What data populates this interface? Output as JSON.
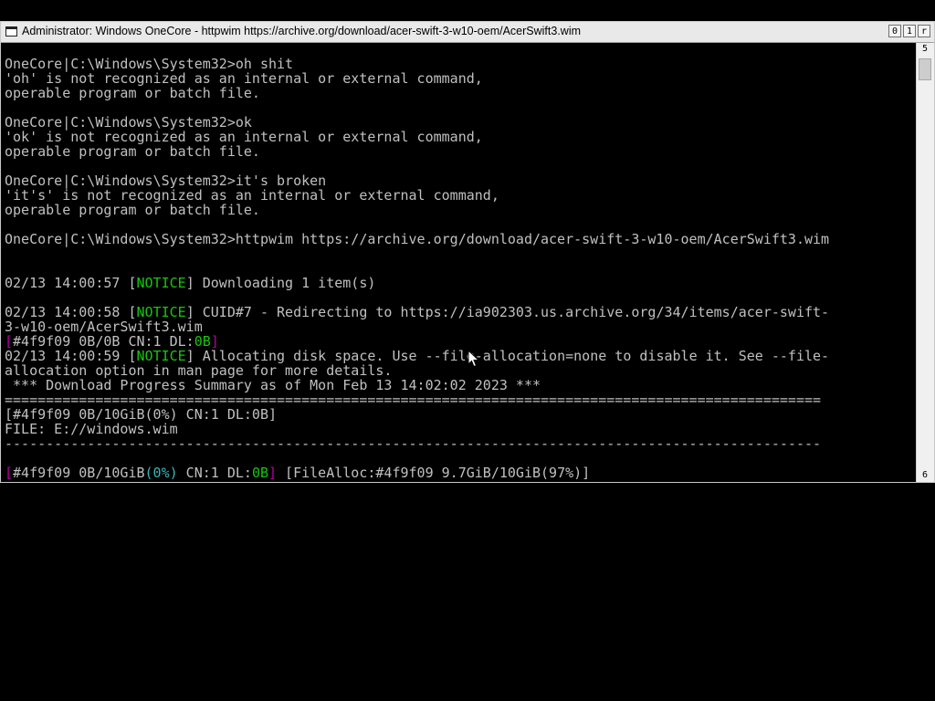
{
  "window": {
    "title": "Administrator:  Windows OneCore - httpwim  https://archive.org/download/acer-swift-3-w10-oem/AcerSwift3.wim",
    "buttons": {
      "minimize": "0",
      "maximize": "1",
      "restore": "r"
    }
  },
  "scrollbar": {
    "up_glyph": "5",
    "down_glyph": "6"
  },
  "console": {
    "l1": "OneCore|C:\\Windows\\System32>oh shit",
    "l2": "'oh' is not recognized as an internal or external command,",
    "l3": "operable program or batch file.",
    "l5": "OneCore|C:\\Windows\\System32>ok",
    "l6": "'ok' is not recognized as an internal or external command,",
    "l7": "operable program or batch file.",
    "l9": "OneCore|C:\\Windows\\System32>it's broken",
    "l10": "'it's' is not recognized as an internal or external command,",
    "l11": "operable program or batch file.",
    "l13": "OneCore|C:\\Windows\\System32>httpwim https://archive.org/download/acer-swift-3-w10-oem/AcerSwift3.wim",
    "l16_time": "02/13 14:00:57 ",
    "l16_tag": "NOTICE",
    "l16_msg": "] Downloading 1 item(s)",
    "l18_time": "02/13 14:00:58 ",
    "l18_tag": "NOTICE",
    "l18_msg": "] CUID#7 - Redirecting to https://ia902303.us.archive.org/34/items/acer-swift-",
    "l19": "3-w10-oem/AcerSwift3.wim",
    "l20_open": "[",
    "l20_body": "#4f9f09 0B/0B CN:1 DL:",
    "l20_dl": "0B",
    "l20_close": "]",
    "l21_time": "02/13 14:00:59 ",
    "l21_tag": "NOTICE",
    "l21_msg": "] Allocating disk space. Use --file-allocation=none to disable it. See --file-",
    "l22": "allocation option in man page for more details.",
    "l23": " *** Download Progress Summary as of Mon Feb 13 14:02:02 2023 ***",
    "l24": "===================================================================================================",
    "l25": "[#4f9f09 0B/10GiB(0%) CN:1 DL:0B]",
    "l26": "FILE: E://windows.wim",
    "l27": "---------------------------------------------------------------------------------------------------",
    "l29_open": "[",
    "l29_a": "#4f9f09 0B/10GiB",
    "l29_pct": "(0%)",
    "l29_b": " CN:1 DL:",
    "l29_dl": "0B",
    "l29_close": "]",
    "l29_rest": " [FileAlloc:#4f9f09 9.7GiB/10GiB(97%)]"
  }
}
